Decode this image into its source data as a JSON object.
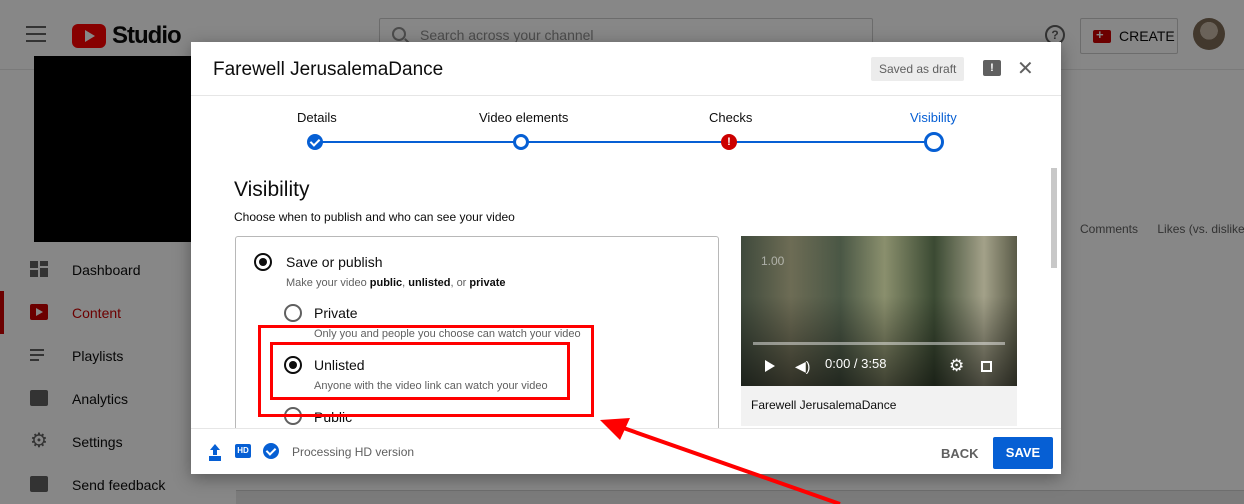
{
  "app": {
    "logo_text": "Studio",
    "search_placeholder": "Search across your channel",
    "create_label": "CREATE",
    "help_glyph": "?"
  },
  "sidebar": {
    "items": [
      {
        "label": "Dashboard",
        "icon": "dashboard-icon",
        "active": false
      },
      {
        "label": "Content",
        "icon": "content-icon",
        "active": true
      },
      {
        "label": "Playlists",
        "icon": "playlists-icon",
        "active": false
      },
      {
        "label": "Analytics",
        "icon": "analytics-icon",
        "active": false
      },
      {
        "label": "Settings",
        "icon": "settings-icon",
        "active": false
      },
      {
        "label": "Send feedback",
        "icon": "feedback-icon",
        "active": false
      }
    ]
  },
  "content_table": {
    "columns": [
      "Comments",
      "Likes (vs. dislike..."
    ]
  },
  "dialog": {
    "title": "Farewell JerusalemaDance",
    "saved_badge": "Saved as draft",
    "close_glyph": "✕",
    "steps": [
      {
        "label": "Details",
        "state": "done"
      },
      {
        "label": "Video elements",
        "state": "open"
      },
      {
        "label": "Checks",
        "state": "error",
        "glyph": "!"
      },
      {
        "label": "Visibility",
        "state": "current"
      }
    ],
    "visibility": {
      "title": "Visibility",
      "description": "Choose when to publish and who can see your video",
      "save_or_publish": {
        "label": "Save or publish",
        "sub_prefix": "Make your video ",
        "sub_public": "public",
        "sub_sep1": ", ",
        "sub_unlisted": "unlisted",
        "sub_sep2": ", or ",
        "sub_private": "private",
        "checked": true
      },
      "options": [
        {
          "label": "Private",
          "sub": "Only you and people you choose can watch your video",
          "checked": false
        },
        {
          "label": "Unlisted",
          "sub": "Anyone with the video link can watch your video",
          "checked": true
        },
        {
          "label": "Public",
          "sub": "",
          "checked": false
        }
      ]
    },
    "preview": {
      "speed": "1.00",
      "time": "0:00 / 3:58",
      "progress": 0,
      "title": "Farewell JerusalemaDance"
    },
    "footer": {
      "hd_badge": "HD",
      "status": "Processing HD version",
      "back_label": "BACK",
      "save_label": "SAVE"
    }
  },
  "annotation": {
    "color": "#ff0000",
    "highlight_target": "Unlisted"
  },
  "colors": {
    "brand_red": "#ff0000",
    "accent_blue": "#065fd4",
    "error_red": "#cc0000"
  }
}
